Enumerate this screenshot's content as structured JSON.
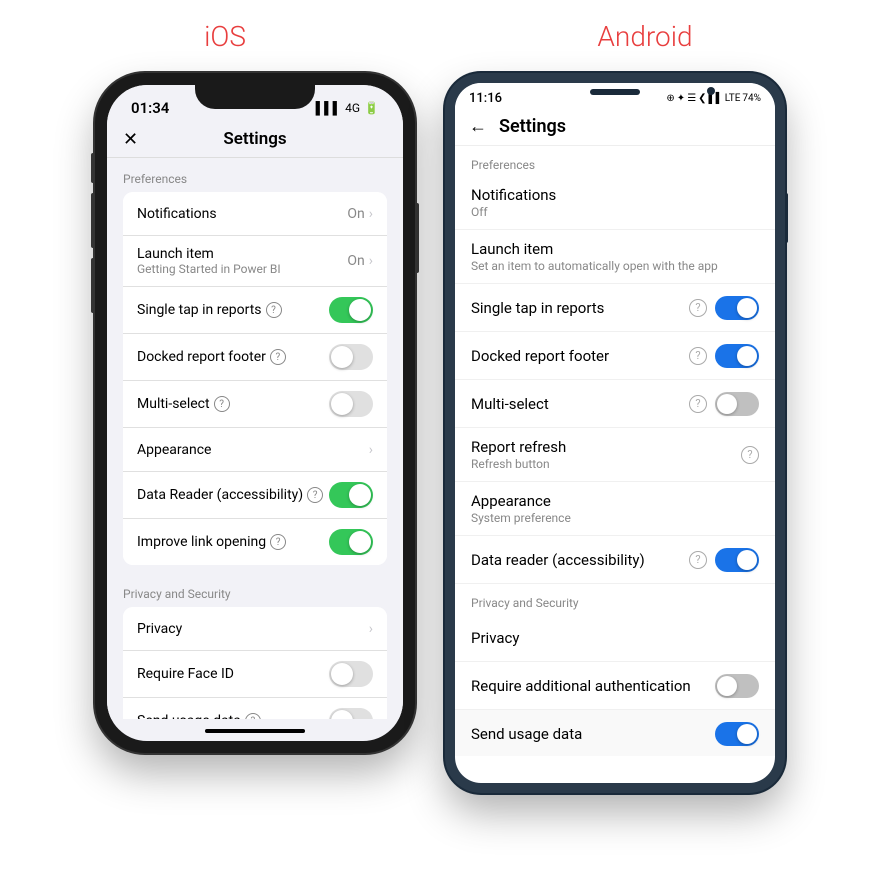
{
  "header": {
    "ios_title": "iOS",
    "android_title": "Android"
  },
  "ios": {
    "status_bar": {
      "time": "01:34",
      "signal": "▌▌▌",
      "network": "4G",
      "battery": "▓▓▓▓"
    },
    "nav": {
      "close": "✕",
      "title": "Settings"
    },
    "sections": [
      {
        "header": "Preferences",
        "items": [
          {
            "label": "Notifications",
            "right_text": "On",
            "has_chevron": true,
            "type": "text"
          },
          {
            "label": "Launch item",
            "sublabel": "Getting Started in Power BI",
            "right_text": "On",
            "has_chevron": true,
            "type": "text"
          },
          {
            "label": "Single tap in reports",
            "has_help": true,
            "toggle": "on",
            "type": "toggle"
          },
          {
            "label": "Docked report footer",
            "has_help": true,
            "toggle": "off",
            "type": "toggle"
          },
          {
            "label": "Multi-select",
            "has_help": true,
            "toggle": "off",
            "type": "toggle"
          },
          {
            "label": "Appearance",
            "has_chevron": true,
            "type": "chevron"
          },
          {
            "label": "Data Reader (accessibility)",
            "has_help": true,
            "toggle": "on",
            "type": "toggle"
          },
          {
            "label": "Improve link opening",
            "has_help": true,
            "toggle": "on",
            "type": "toggle"
          }
        ]
      },
      {
        "header": "Privacy and Security",
        "items": [
          {
            "label": "Privacy",
            "has_chevron": true,
            "type": "chevron"
          },
          {
            "label": "Require Face ID",
            "toggle": "off",
            "type": "toggle"
          },
          {
            "label": "Send usage data",
            "has_help": true,
            "toggle": "off",
            "type": "toggle"
          }
        ]
      }
    ]
  },
  "android": {
    "status_bar": {
      "time": "11:16",
      "icons": "⊕ ☰ ✦ ❮ WiFi LTE 74%"
    },
    "nav": {
      "back": "←",
      "title": "Settings"
    },
    "sections": [
      {
        "header": "Preferences",
        "items": [
          {
            "label": "Notifications",
            "sublabel": "Off",
            "type": "plain"
          },
          {
            "label": "Launch item",
            "sublabel": "Set an item to automatically open with the app",
            "type": "plain"
          },
          {
            "label": "Single tap in reports",
            "has_help": true,
            "toggle": "on",
            "type": "toggle"
          },
          {
            "label": "Docked report footer",
            "has_help": true,
            "toggle": "on",
            "type": "toggle"
          },
          {
            "label": "Multi-select",
            "has_help": true,
            "toggle": "off",
            "type": "toggle"
          },
          {
            "label": "Report refresh",
            "sublabel": "Refresh button",
            "has_help": true,
            "type": "plain-help"
          },
          {
            "label": "Appearance",
            "sublabel": "System preference",
            "type": "plain"
          },
          {
            "label": "Data reader (accessibility)",
            "has_help": true,
            "toggle": "on",
            "type": "toggle"
          }
        ]
      },
      {
        "header": "Privacy and Security",
        "items": [
          {
            "label": "Privacy",
            "type": "plain"
          },
          {
            "label": "Require additional authentication",
            "toggle": "off",
            "type": "toggle"
          },
          {
            "label": "Send usage data",
            "toggle": "on",
            "type": "toggle"
          }
        ]
      }
    ]
  }
}
